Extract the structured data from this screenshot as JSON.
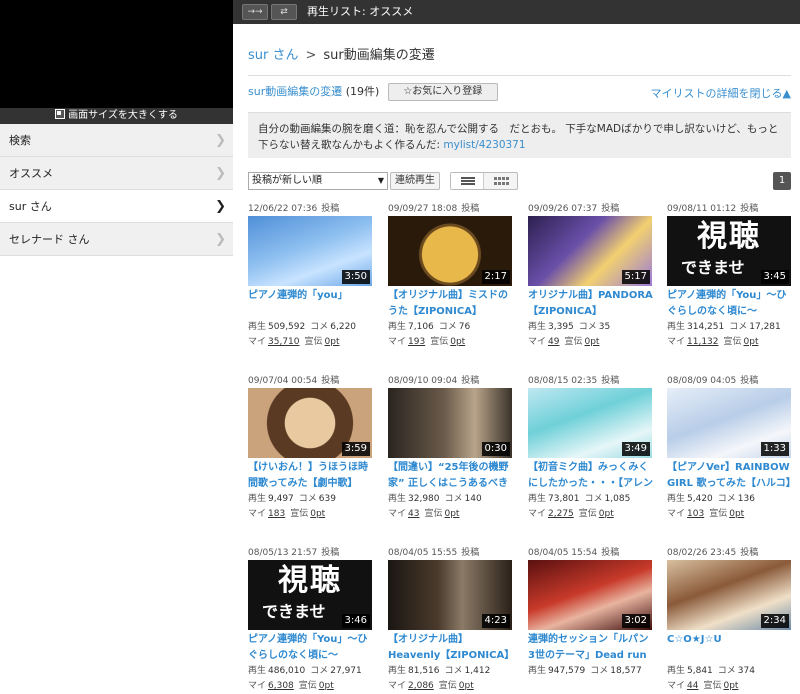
{
  "player": {
    "enlarge_label": "画面サイズを大きくする"
  },
  "nav": [
    {
      "label": "検索",
      "active": false
    },
    {
      "label": "オススメ",
      "active": false
    },
    {
      "label": "sur さん",
      "active": true
    },
    {
      "label": "セレナード さん",
      "active": false
    }
  ],
  "topbar": {
    "title": "再生リスト: オススメ"
  },
  "breadcrumb": {
    "user": "sur さん",
    "sep": ">",
    "current": "sur動画編集の変遷"
  },
  "mylist": {
    "name": "sur動画編集の変遷",
    "count": "(19件)",
    "fav_button": "☆お気に入り登録",
    "close_details": "マイリストの詳細を閉じる▲",
    "description_text": "自分の動画編集の腕を磨く道：恥を忍んで公開する　だとおも。 下手なMADばかりで申し訳ないけど、もっと下らない替え歌なんかもよく作るんだ: ",
    "description_link": "mylist/4230371"
  },
  "controls": {
    "sort": "投稿が新しい順",
    "continuous": "連続再生",
    "page": "1"
  },
  "colors": {
    "accent": "#3a8fcf",
    "bar": "#333333",
    "selected": "#555555"
  },
  "videos": [
    {
      "date": "12/06/22 07:36",
      "posted": "投稿",
      "duration": "3:50",
      "title": "ピアノ連弾的「you」",
      "views": "509,592",
      "comments": "6,220",
      "mylists": "35,710",
      "ads": "0pt",
      "thumb": "a"
    },
    {
      "date": "09/09/27 18:08",
      "posted": "投稿",
      "duration": "2:17",
      "title": "【オリジナル曲】ミスドのうた【ZIPONICA】",
      "views": "7,106",
      "comments": "76",
      "mylists": "193",
      "ads": "0pt",
      "thumb": "b"
    },
    {
      "date": "09/09/26 07:37",
      "posted": "投稿",
      "duration": "5:17",
      "title": "オリジナル曲】PANDORA【ZIPONICA】",
      "views": "3,395",
      "comments": "35",
      "mylists": "49",
      "ads": "0pt",
      "thumb": "c"
    },
    {
      "date": "09/08/11 01:12",
      "posted": "投稿",
      "duration": "3:45",
      "title": "ピアノ連弾的「You」～ひぐらしのなく頃に～",
      "views": "314,251",
      "comments": "17,281",
      "mylists": "11,132",
      "ads": "0pt",
      "thumb": "k"
    },
    {
      "date": "09/07/04 00:54",
      "posted": "投稿",
      "duration": "3:59",
      "title": "【けいおん！】うほうほ時間歌ってみた【劇中歌】",
      "views": "9,497",
      "comments": "639",
      "mylists": "183",
      "ads": "0pt",
      "thumb": "d"
    },
    {
      "date": "08/09/10 09:04",
      "posted": "投稿",
      "duration": "0:30",
      "title": "【間違い】“25年後の機野家” 正しくはこうあるべきだ！　【直し】",
      "views": "32,980",
      "comments": "140",
      "mylists": "43",
      "ads": "0pt",
      "thumb": "e"
    },
    {
      "date": "08/08/15 02:35",
      "posted": "投稿",
      "duration": "3:49",
      "title": "【初音ミク曲】みっくみくにしたかった・・・【アレンジMAD付き】",
      "views": "73,801",
      "comments": "1,085",
      "mylists": "2,275",
      "ads": "0pt",
      "thumb": "f"
    },
    {
      "date": "08/08/09 04:05",
      "posted": "投稿",
      "duration": "1:33",
      "title": "【ピアノVer】RAINBOW GIRL 歌ってみた【ハルコ】",
      "views": "5,420",
      "comments": "136",
      "mylists": "103",
      "ads": "0pt",
      "thumb": "g"
    },
    {
      "date": "08/05/13 21:57",
      "posted": "投稿",
      "duration": "3:46",
      "title": "ピアノ連弾的「You」～ひぐらしのなく頃に～",
      "views": "486,010",
      "comments": "27,971",
      "mylists": "6,308",
      "ads": "0pt",
      "thumb": "k"
    },
    {
      "date": "08/04/05 15:55",
      "posted": "投稿",
      "duration": "4:23",
      "title": "【オリジナル曲】Heavenly【ZIPONICA】",
      "views": "81,516",
      "comments": "1,412",
      "mylists": "2,086",
      "ads": "0pt",
      "thumb": "h"
    },
    {
      "date": "08/04/05 15:54",
      "posted": "投稿",
      "duration": "3:02",
      "title": "連弾的セッション「ルパン3世のテーマ」Dead run ver.",
      "views": "947,579",
      "comments": "18,577",
      "mylists": "",
      "ads": "",
      "thumb": "i"
    },
    {
      "date": "08/02/26 23:45",
      "posted": "投稿",
      "duration": "2:34",
      "title": "C☆O★J☆U",
      "views": "5,841",
      "comments": "374",
      "mylists": "44",
      "ads": "0pt",
      "thumb": "j"
    }
  ],
  "labels": {
    "views": "再生",
    "comments": "コメ",
    "mylists": "マイ",
    "ads": "宣伝"
  },
  "thumb_text": {
    "big": "視聴",
    "small": "できませ"
  }
}
